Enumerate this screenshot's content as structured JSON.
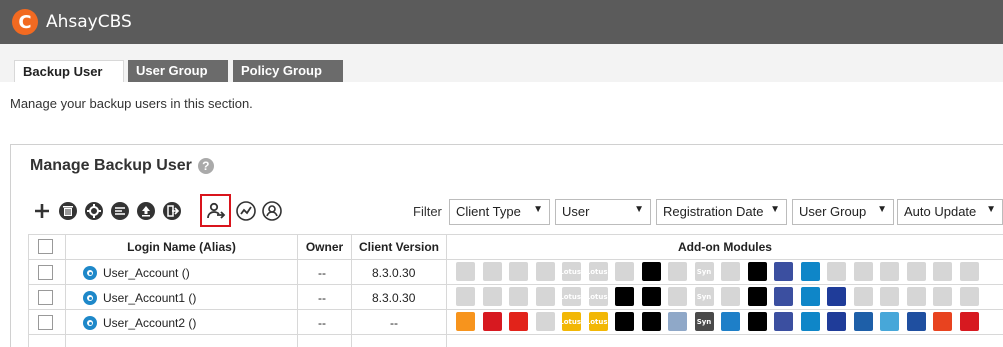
{
  "app": {
    "title": "AhsayCBS",
    "logo_letter": "C"
  },
  "tabs": [
    {
      "label": "Backup User",
      "active": true
    },
    {
      "label": "User Group",
      "active": false
    },
    {
      "label": "Policy Group",
      "active": false
    }
  ],
  "description": "Manage your backup users in this section.",
  "section": {
    "title": "Manage Backup User",
    "help": "?"
  },
  "toolbar": {
    "icons": [
      "add-icon",
      "delete-icon",
      "settings-icon",
      "list-icon",
      "upload-icon",
      "export-icon",
      "assign-icon",
      "chart-icon",
      "group-icon"
    ],
    "highlighted": "assign-icon"
  },
  "filter": {
    "label": "Filter",
    "selects": [
      {
        "value": "Client Type"
      },
      {
        "value": "User"
      },
      {
        "value": "Registration Date"
      },
      {
        "value": "User Group"
      },
      {
        "value": "Auto Update"
      }
    ]
  },
  "table": {
    "headers": {
      "login": "Login Name (Alias)",
      "owner": "Owner",
      "version": "Client Version",
      "modules": "Add-on Modules"
    },
    "rows": [
      {
        "login": "User_Account ()",
        "owner": "--",
        "version": "8.3.0.30",
        "modules_active": [
          false,
          false,
          false,
          false,
          false,
          false,
          false,
          true,
          false,
          false,
          false,
          true,
          true,
          true,
          false,
          false,
          false,
          false,
          false,
          false
        ]
      },
      {
        "login": "User_Account1 ()",
        "owner": "--",
        "version": "8.3.0.30",
        "modules_active": [
          false,
          false,
          false,
          false,
          false,
          false,
          true,
          true,
          false,
          false,
          false,
          true,
          true,
          true,
          true,
          false,
          false,
          false,
          false,
          false
        ]
      },
      {
        "login": "User_Account2 ()",
        "owner": "--",
        "version": "--",
        "modules_active": [
          true,
          true,
          true,
          false,
          true,
          true,
          true,
          true,
          true,
          true,
          true,
          true,
          true,
          true,
          true,
          true,
          true,
          true,
          true,
          true
        ]
      }
    ]
  },
  "modules": [
    {
      "name": "exchange-icon",
      "color": "#f7941d",
      "label": ""
    },
    {
      "name": "sql-icon",
      "color": "#d71920",
      "label": ""
    },
    {
      "name": "oracle-icon",
      "color": "#e2231a",
      "label": ""
    },
    {
      "name": "mysql-icon",
      "color": "#9a9a9a",
      "label": ""
    },
    {
      "name": "lotus-domino-icon",
      "color": "#f2b705",
      "label": "Lotus."
    },
    {
      "name": "lotus-notes-icon",
      "color": "#f2b705",
      "label": "Lotus."
    },
    {
      "name": "shadowprotect-icon",
      "color": "#000000",
      "label": ""
    },
    {
      "name": "volume-icon",
      "color": "#000000",
      "label": ""
    },
    {
      "name": "mail-icon",
      "color": "#8fa8c8",
      "label": ""
    },
    {
      "name": "synology-nas-icon",
      "color": "#4a4a4a",
      "label": "Syn"
    },
    {
      "name": "qnap-nas-icon",
      "color": "#1e7fc8",
      "label": ""
    },
    {
      "name": "cdp-icon",
      "color": "#000000",
      "label": ""
    },
    {
      "name": "hyperv-icon",
      "color": "#3b4fa0",
      "label": ""
    },
    {
      "name": "vmware-icon",
      "color": "#0f86c8",
      "label": ""
    },
    {
      "name": "restore-icon",
      "color": "#1f3c99",
      "label": ""
    },
    {
      "name": "windows-icon",
      "color": "#1e5fa8",
      "label": ""
    },
    {
      "name": "system-icon",
      "color": "#47a7d9",
      "label": ""
    },
    {
      "name": "office365-icon",
      "color": "#1f4fa0",
      "label": ""
    },
    {
      "name": "office-icon",
      "color": "#e8431f",
      "label": ""
    },
    {
      "name": "cloud-icon",
      "color": "#d71920",
      "label": ""
    }
  ],
  "colors": {
    "header": "#5b5b5b",
    "accent": "#f26a21",
    "highlight": "#d9141c",
    "inactive": "#d6d6d6"
  }
}
